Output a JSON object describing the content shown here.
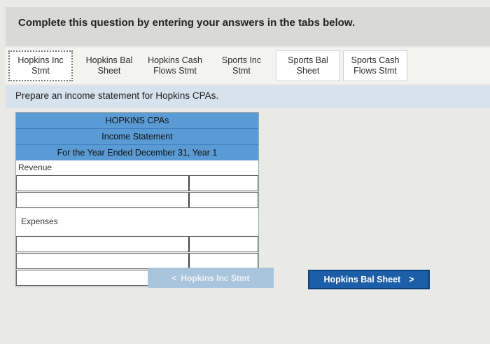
{
  "header": {
    "instruction": "Complete this question by entering your answers in the tabs below."
  },
  "tabs": [
    {
      "line1": "Hopkins Inc",
      "line2": "Stmt"
    },
    {
      "line1": "Hopkins Bal",
      "line2": "Sheet"
    },
    {
      "line1": "Hopkins Cash",
      "line2": "Flows Stmt"
    },
    {
      "line1": "Sports Inc",
      "line2": "Stmt"
    },
    {
      "line1": "Sports Bal",
      "line2": "Sheet"
    },
    {
      "line1": "Sports Cash",
      "line2": "Flows Stmt"
    }
  ],
  "prompt": "Prepare an income statement for Hopkins CPAs.",
  "statement": {
    "company": "HOPKINS CPAs",
    "title": "Income Statement",
    "period": "For the Year Ended December 31, Year 1",
    "revenue_label": "Revenue",
    "expenses_label": "Expenses"
  },
  "nav": {
    "prev_label": "Hopkins Inc Stmt",
    "prev_glyph": "<",
    "next_label": "Hopkins Bal Sheet",
    "next_glyph": ">"
  }
}
